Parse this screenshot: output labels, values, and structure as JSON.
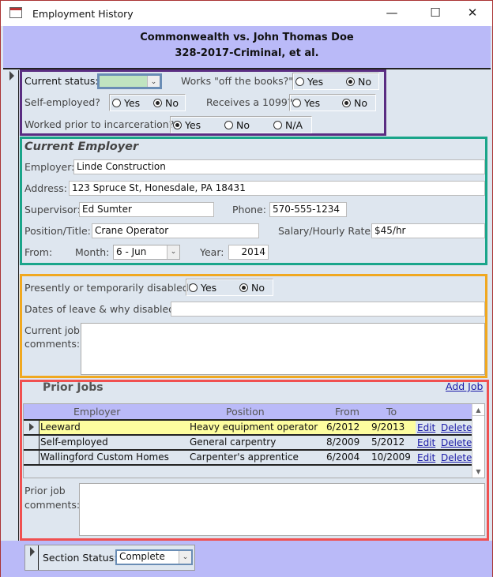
{
  "window": {
    "title": "Employment History",
    "minimize": "—",
    "maximize": "☐",
    "close": "✕"
  },
  "header": {
    "line1": "Commonwealth vs. John Thomas Doe",
    "line2": "328-2017-Criminal, et al."
  },
  "status": {
    "current_status_label": "Current status:",
    "current_status_value": "",
    "off_books_label": "Works \"off the books?\"",
    "off_books": "No",
    "self_employed_label": "Self-employed?",
    "self_employed": "No",
    "receives_1099_label": "Receives a 1099?",
    "receives_1099": "No",
    "worked_prior_label": "Worked prior to incarceration?",
    "worked_prior": "Yes",
    "yes": "Yes",
    "no": "No",
    "na": "N/A"
  },
  "current_employer": {
    "heading": "Current Employer",
    "employer_label": "Employer:",
    "employer": "Linde Construction",
    "address_label": "Address:",
    "address": "123 Spruce St, Honesdale, PA 18431",
    "supervisor_label": "Supervisor:",
    "supervisor": "Ed Sumter",
    "phone_label": "Phone:",
    "phone": "570-555-1234",
    "position_label": "Position/Title:",
    "position": "Crane Operator",
    "salary_label": "Salary/Hourly Rate:",
    "salary": "$45/hr",
    "from_label": "From:",
    "month_label": "Month:",
    "month": "6 - Jun",
    "year_label": "Year:",
    "year": "2014"
  },
  "disability": {
    "disabled_label": "Presently or temporarily disabled?",
    "disabled": "No",
    "dates_label": "Dates of leave & why disabled:",
    "dates": "",
    "comments_label_1": "Current job",
    "comments_label_2": "comments:",
    "comments": ""
  },
  "prior_jobs": {
    "heading": "Prior Jobs",
    "add_link": "Add Job",
    "columns": [
      "Employer",
      "Position",
      "From",
      "To"
    ],
    "edit": "Edit",
    "delete": "Delete",
    "rows": [
      {
        "employer": "Leeward",
        "position": "Heavy equipment operator",
        "from": "6/2012",
        "to": "9/2013"
      },
      {
        "employer": "Self-employed",
        "position": "General carpentry",
        "from": "8/2009",
        "to": "5/2012"
      },
      {
        "employer": "Wallingford Custom Homes",
        "position": "Carpenter's apprentice",
        "from": "6/2004",
        "to": "10/2009"
      }
    ],
    "comments_label_1": "Prior job",
    "comments_label_2": "comments:",
    "comments": ""
  },
  "footer": {
    "section_status_label": "Section Status:",
    "section_status": "Complete"
  },
  "colors": {
    "header": "#babaf8",
    "status_box": "#5a2d82",
    "employer_box": "#1aa58a",
    "disability_box": "#f0a820",
    "prior_box": "#f05050",
    "selected_row": "#fdfd9f"
  }
}
